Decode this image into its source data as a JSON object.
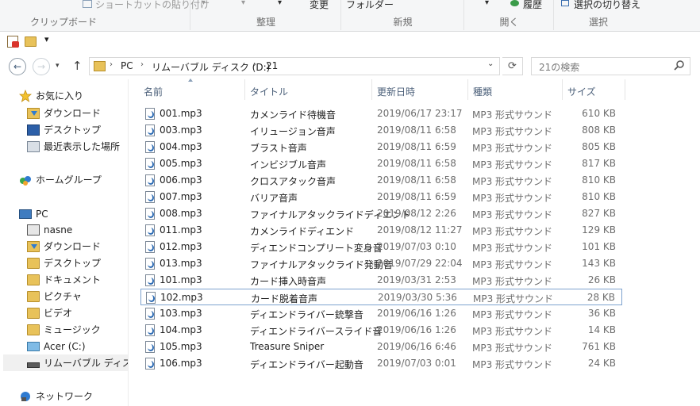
{
  "ribbon": {
    "clipboard": {
      "paste_shortcut": "ショートカットの貼り付け",
      "group_label": "クリップボード"
    },
    "organize": {
      "rename": "変更",
      "group_label": "整理"
    },
    "new": {
      "new_folder": "フォルダー",
      "group_label": "新規"
    },
    "open": {
      "history": "履歴",
      "group_label": "開く"
    },
    "select": {
      "invert": "選択の切り替え",
      "group_label": "選択"
    }
  },
  "address": {
    "crumbs": [
      "PC",
      "リムーバブル ディスク (D:)",
      "21"
    ]
  },
  "search": {
    "placeholder": "21の検索"
  },
  "sidebar": {
    "favorites": "お気に入り",
    "fav_items": [
      "ダウンロード",
      "デスクトップ",
      "最近表示した場所"
    ],
    "homegroup": "ホームグループ",
    "pc": "PC",
    "pc_items": [
      "nasne",
      "ダウンロード",
      "デスクトップ",
      "ドキュメント",
      "ピクチャ",
      "ビデオ",
      "ミュージック",
      "Acer (C:)",
      "リムーバブル ディスク (D:)"
    ],
    "network": "ネットワーク"
  },
  "columns": {
    "name": "名前",
    "title": "タイトル",
    "date": "更新日時",
    "type": "種類",
    "size": "サイズ"
  },
  "files": [
    {
      "name": "001.mp3",
      "title": "カメンライド待機音",
      "date": "2019/06/17 23:17",
      "type": "MP3 形式サウンド",
      "size": "610 KB"
    },
    {
      "name": "003.mp3",
      "title": "イリュージョン音声",
      "date": "2019/08/11 6:58",
      "type": "MP3 形式サウンド",
      "size": "808 KB"
    },
    {
      "name": "004.mp3",
      "title": "ブラスト音声",
      "date": "2019/08/11 6:59",
      "type": "MP3 形式サウンド",
      "size": "805 KB"
    },
    {
      "name": "005.mp3",
      "title": "インビジブル音声",
      "date": "2019/08/11 6:58",
      "type": "MP3 形式サウンド",
      "size": "817 KB"
    },
    {
      "name": "006.mp3",
      "title": "クロスアタック音声",
      "date": "2019/08/11 6:58",
      "type": "MP3 形式サウンド",
      "size": "810 KB"
    },
    {
      "name": "007.mp3",
      "title": "バリア音声",
      "date": "2019/08/11 6:59",
      "type": "MP3 形式サウンド",
      "size": "810 KB"
    },
    {
      "name": "008.mp3",
      "title": "ファイナルアタックライドディエンド",
      "date": "2019/08/12 2:26",
      "type": "MP3 形式サウンド",
      "size": "827 KB"
    },
    {
      "name": "011.mp3",
      "title": "カメンライドディエンド",
      "date": "2019/08/12 11:27",
      "type": "MP3 形式サウンド",
      "size": "129 KB"
    },
    {
      "name": "012.mp3",
      "title": "ディエンドコンプリート変身音",
      "date": "2019/07/03 0:10",
      "type": "MP3 形式サウンド",
      "size": "101 KB"
    },
    {
      "name": "013.mp3",
      "title": "ファイナルアタックライド発動音",
      "date": "2019/07/29 22:04",
      "type": "MP3 形式サウンド",
      "size": "143 KB"
    },
    {
      "name": "101.mp3",
      "title": "カード挿入時音声",
      "date": "2019/03/31 2:53",
      "type": "MP3 形式サウンド",
      "size": "26 KB"
    },
    {
      "name": "102.mp3",
      "title": "カード脱着音声",
      "date": "2019/03/30 5:36",
      "type": "MP3 形式サウンド",
      "size": "28 KB"
    },
    {
      "name": "103.mp3",
      "title": "ディエンドライバー銃撃音",
      "date": "2019/06/16 1:26",
      "type": "MP3 形式サウンド",
      "size": "36 KB"
    },
    {
      "name": "104.mp3",
      "title": "ディエンドライバースライド音",
      "date": "2019/06/16 1:26",
      "type": "MP3 形式サウンド",
      "size": "14 KB"
    },
    {
      "name": "105.mp3",
      "title": "Treasure Sniper",
      "date": "2019/06/16 6:46",
      "type": "MP3 形式サウンド",
      "size": "761 KB"
    },
    {
      "name": "106.mp3",
      "title": "ディエンドライバー起動音",
      "date": "2019/07/03 0:01",
      "type": "MP3 形式サウンド",
      "size": "24 KB"
    }
  ],
  "selected_file": "102.mp3"
}
